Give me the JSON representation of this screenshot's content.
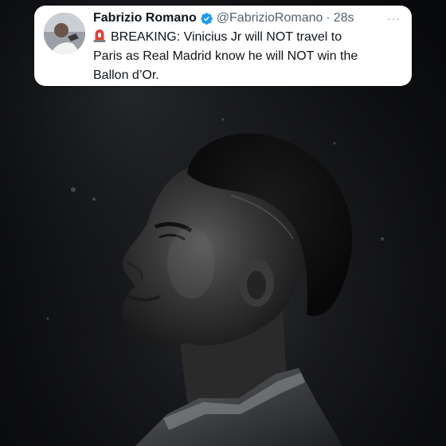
{
  "tweet": {
    "display_name": "Fabrizio Romano",
    "handle": "@FabrizioRomano",
    "separator": "·",
    "time": "28s",
    "more": "···",
    "text_lines": [
      "BREAKING: Vinicius Jr will NOT travel to",
      "Paris as Real Madrid know he will NOT win the",
      "Ballon d’Or."
    ],
    "icons": {
      "avatar": "profile-photo",
      "verified": "verified-badge-icon",
      "siren": "siren-emoji-icon",
      "more": "more-options-icon"
    },
    "colors": {
      "verified": "#1d9bf0",
      "siren": "#e0403a",
      "text": "#0f1419",
      "secondary": "#536471"
    }
  },
  "photo": {
    "description_icon": "player-portrait"
  }
}
